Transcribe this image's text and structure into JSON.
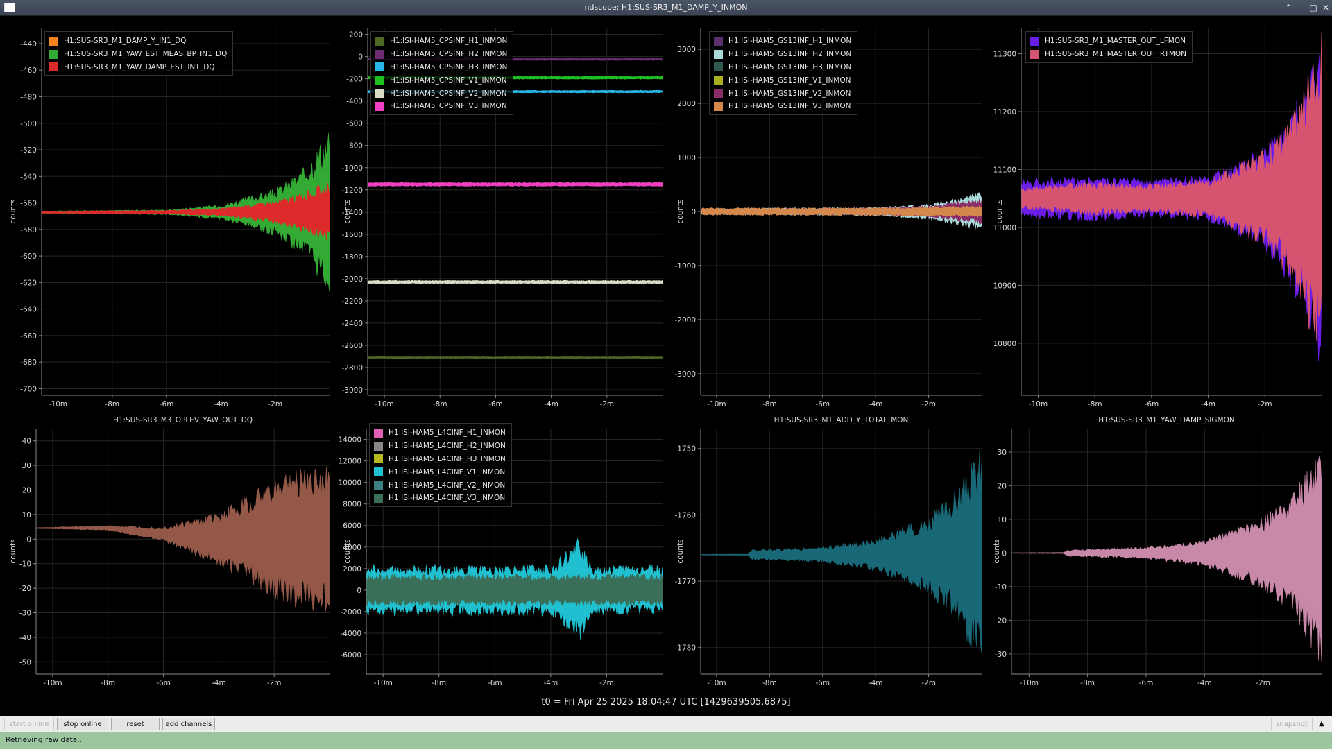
{
  "window": {
    "title": "ndscope: H1:SUS-SR3_M1_DAMP_Y_INMON"
  },
  "x_axis": {
    "ticks": [
      "-10m",
      "-8m",
      "-6m",
      "-4m",
      "-2m"
    ],
    "values": [
      -10,
      -8,
      -6,
      -4,
      -2
    ],
    "xlim": [
      -10.6,
      0
    ]
  },
  "plots": [
    {
      "title": "",
      "ylabel": "counts",
      "ylim": [
        -705,
        -428
      ],
      "yticks": [
        -440,
        -460,
        -480,
        -500,
        -520,
        -540,
        -560,
        -580,
        -600,
        -620,
        -640,
        -660,
        -680,
        -700
      ],
      "legend": [
        {
          "name": "H1:SUS-SR3_M1_DAMP_Y_IN1_DQ",
          "color": "#f58220"
        },
        {
          "name": "H1:SUS-SR3_M1_YAW_EST_MEAS_BP_IN1_DQ",
          "color": "#33aa33"
        },
        {
          "name": "H1:SUS-SR3_M1_YAW_DAMP_EST_IN1_DQ",
          "color": "#dd2a2a"
        }
      ]
    },
    {
      "title": "",
      "ylabel": "counts",
      "ylim": [
        -3050,
        260
      ],
      "yticks": [
        200,
        0,
        -200,
        -400,
        -600,
        -800,
        -1000,
        -1200,
        -1400,
        -1600,
        -1800,
        -2000,
        -2200,
        -2400,
        -2600,
        -2800,
        -3000
      ],
      "legend": [
        {
          "name": "H1:ISI-HAM5_CPSINF_H1_INMON",
          "color": "#4e6a22"
        },
        {
          "name": "H1:ISI-HAM5_CPSINF_H2_INMON",
          "color": "#6b2c72"
        },
        {
          "name": "H1:ISI-HAM5_CPSINF_H3_INMON",
          "color": "#29b6e6"
        },
        {
          "name": "H1:ISI-HAM5_CPSINF_V1_INMON",
          "color": "#20c020"
        },
        {
          "name": "H1:ISI-HAM5_CPSINF_V2_INMON",
          "color": "#d8ddc8"
        },
        {
          "name": "H1:ISI-HAM5_CPSINF_V3_INMON",
          "color": "#ee40c0"
        }
      ]
    },
    {
      "title": "",
      "ylabel": "counts",
      "ylim": [
        -3400,
        3400
      ],
      "yticks": [
        3000,
        2000,
        1000,
        0,
        -1000,
        -2000,
        -3000
      ],
      "legend": [
        {
          "name": "H1:ISI-HAM5_GS13INF_H1_INMON",
          "color": "#5a2f6e"
        },
        {
          "name": "H1:ISI-HAM5_GS13INF_H2_INMON",
          "color": "#a8d8d8"
        },
        {
          "name": "H1:ISI-HAM5_GS13INF_H3_INMON",
          "color": "#2e5a50"
        },
        {
          "name": "H1:ISI-HAM5_GS13INF_V1_INMON",
          "color": "#a8b020"
        },
        {
          "name": "H1:ISI-HAM5_GS13INF_V2_INMON",
          "color": "#8a2e6a"
        },
        {
          "name": "H1:ISI-HAM5_GS13INF_V3_INMON",
          "color": "#d4884c"
        }
      ]
    },
    {
      "title": "",
      "ylabel": "counts",
      "ylim": [
        10710,
        11345
      ],
      "yticks": [
        11300,
        11200,
        11100,
        11000,
        10900,
        10800
      ],
      "legend": [
        {
          "name": "H1:SUS-SR3_M1_MASTER_OUT_LFMON",
          "color": "#6a1ee8"
        },
        {
          "name": "H1:SUS-SR3_M1_MASTER_OUT_RTMON",
          "color": "#d65470"
        }
      ]
    },
    {
      "title": "H1:SUS-SR3_M3_OPLEV_YAW_OUT_DQ",
      "ylabel": "counts",
      "ylim": [
        -55,
        45
      ],
      "yticks": [
        40,
        30,
        20,
        10,
        0,
        -10,
        -20,
        -30,
        -40,
        -50
      ],
      "legend": []
    },
    {
      "title": "",
      "ylabel": "counts",
      "ylim": [
        -7800,
        15000
      ],
      "yticks": [
        14000,
        12000,
        10000,
        8000,
        6000,
        4000,
        2000,
        0,
        -2000,
        -4000,
        -6000
      ],
      "legend": [
        {
          "name": "H1:ISI-HAM5_L4CINF_H1_INMON",
          "color": "#e060b8"
        },
        {
          "name": "H1:ISI-HAM5_L4CINF_H2_INMON",
          "color": "#888888"
        },
        {
          "name": "H1:ISI-HAM5_L4CINF_H3_INMON",
          "color": "#b8b820"
        },
        {
          "name": "H1:ISI-HAM5_L4CINF_V1_INMON",
          "color": "#20c0d0"
        },
        {
          "name": "H1:ISI-HAM5_L4CINF_V2_INMON",
          "color": "#3a8080"
        },
        {
          "name": "H1:ISI-HAM5_L4CINF_V3_INMON",
          "color": "#3a6e58"
        }
      ]
    },
    {
      "title": "H1:SUS-SR3_M1_ADD_Y_TOTAL_MON",
      "ylabel": "counts",
      "ylim": [
        -1784,
        -1747
      ],
      "yticks": [
        -1750,
        -1760,
        -1770,
        -1780
      ],
      "legend": []
    },
    {
      "title": "H1:SUS-SR3_M1_YAW_DAMP_SIGMON",
      "ylabel": "counts",
      "ylim": [
        -36,
        37
      ],
      "yticks": [
        30,
        20,
        10,
        0,
        -10,
        -20,
        -30
      ],
      "legend": []
    }
  ],
  "chart_data": [
    {
      "type": "area",
      "ylabel": "counts",
      "series": [
        {
          "name": "H1:SUS-SR3_M1_YAW_EST_MEAS_BP_IN1_DQ",
          "color": "#33aa33",
          "x": [
            -10.6,
            -6,
            -4,
            -2,
            -1,
            0
          ],
          "center": [
            -567,
            -567,
            -567,
            -567,
            -567,
            -567
          ],
          "amp": [
            1,
            2,
            6,
            18,
            33,
            65
          ]
        },
        {
          "name": "H1:SUS-SR3_M1_YAW_DAMP_EST_IN1_DQ",
          "color": "#dd2a2a",
          "x": [
            -10.6,
            -6,
            -4,
            -2,
            -1,
            0
          ],
          "center": [
            -567,
            -567,
            -567,
            -567,
            -567,
            -567
          ],
          "amp": [
            1,
            1.5,
            3,
            9,
            15,
            24
          ]
        }
      ]
    },
    {
      "type": "area",
      "ylabel": "counts",
      "series": [
        {
          "name": "H1:ISI-HAM5_CPSINF_H2_INMON",
          "color": "#6b2c72",
          "x": [
            -10.6,
            0
          ],
          "center": [
            -25,
            -25
          ],
          "amp": [
            10,
            10
          ]
        },
        {
          "name": "H1:ISI-HAM5_CPSINF_V1_INMON",
          "color": "#20c020",
          "x": [
            -10.6,
            0
          ],
          "center": [
            -190,
            -190
          ],
          "amp": [
            14,
            14
          ]
        },
        {
          "name": "H1:ISI-HAM5_CPSINF_H3_INMON",
          "color": "#29b6e6",
          "x": [
            -10.6,
            0
          ],
          "center": [
            -315,
            -315
          ],
          "amp": [
            12,
            12
          ]
        },
        {
          "name": "H1:ISI-HAM5_CPSINF_V3_INMON",
          "color": "#ee40c0",
          "x": [
            -10.6,
            0
          ],
          "center": [
            -1150,
            -1150
          ],
          "amp": [
            18,
            18
          ]
        },
        {
          "name": "H1:ISI-HAM5_CPSINF_V2_INMON",
          "color": "#d8ddc8",
          "x": [
            -10.6,
            0
          ],
          "center": [
            -2030,
            -2030
          ],
          "amp": [
            16,
            16
          ]
        },
        {
          "name": "H1:ISI-HAM5_CPSINF_H1_INMON",
          "color": "#4e6a22",
          "x": [
            -10.6,
            0
          ],
          "center": [
            -2710,
            -2710
          ],
          "amp": [
            8,
            8
          ]
        }
      ]
    },
    {
      "type": "area",
      "ylabel": "counts",
      "series": [
        {
          "name": "H1:ISI-HAM5_GS13INF_H2_INMON",
          "color": "#a8d8d8",
          "x": [
            -10.6,
            -4,
            -2,
            -1,
            0
          ],
          "center": [
            0,
            0,
            0,
            0,
            0
          ],
          "amp": [
            60,
            80,
            150,
            250,
            380
          ]
        },
        {
          "name": "H1:ISI-HAM5_GS13INF_V2_INMON",
          "color": "#8a2e6a",
          "x": [
            -10.6,
            -4,
            -2,
            -1,
            0
          ],
          "center": [
            0,
            0,
            0,
            0,
            0
          ],
          "amp": [
            50,
            70,
            110,
            180,
            250
          ]
        },
        {
          "name": "H1:ISI-HAM5_GS13INF_V3_INMON",
          "color": "#d4884c",
          "x": [
            -10.6,
            -4,
            -2,
            -1,
            0
          ],
          "center": [
            0,
            0,
            0,
            0,
            0
          ],
          "amp": [
            70,
            80,
            90,
            100,
            110
          ]
        }
      ]
    },
    {
      "type": "area",
      "ylabel": "counts",
      "series": [
        {
          "name": "H1:SUS-SR3_M1_MASTER_OUT_LFMON",
          "color": "#6a1ee8",
          "x": [
            -10.6,
            -8,
            -6,
            -4,
            -2,
            -1,
            0
          ],
          "center": [
            11050,
            11050,
            11050,
            11050,
            11050,
            11050,
            11050
          ],
          "amp": [
            35,
            40,
            35,
            40,
            90,
            160,
            300
          ]
        },
        {
          "name": "H1:SUS-SR3_M1_MASTER_OUT_RTMON",
          "color": "#d65470",
          "x": [
            -10.6,
            -8,
            -6,
            -4,
            -2,
            -1,
            0
          ],
          "center": [
            11050,
            11050,
            11050,
            11050,
            11050,
            11050,
            11050
          ],
          "amp": [
            20,
            30,
            25,
            35,
            85,
            150,
            290
          ]
        }
      ]
    },
    {
      "type": "area",
      "title": "H1:SUS-SR3_M3_OPLEV_YAW_OUT_DQ",
      "ylabel": "counts",
      "series": [
        {
          "color": "#945848",
          "x": [
            -10.6,
            -8,
            -6,
            -4,
            -2,
            -1,
            0
          ],
          "center": [
            4.5,
            4.5,
            2,
            0,
            0,
            0,
            0
          ],
          "amp": [
            0.2,
            1,
            3,
            11,
            25,
            30,
            30
          ]
        }
      ]
    },
    {
      "type": "area",
      "ylabel": "counts",
      "series": [
        {
          "name": "H1:ISI-HAM5_L4CINF_V1_INMON",
          "color": "#20c0d0",
          "x": [
            -10.6,
            -4,
            -3.1,
            -3,
            -2.5,
            0
          ],
          "center": [
            0,
            0,
            0,
            0,
            0,
            0
          ],
          "amp": [
            2400,
            2400,
            4500,
            5200,
            2400,
            2400
          ]
        },
        {
          "name": "H1:ISI-HAM5_L4CINF_V3_INMON",
          "color": "#3a6e58",
          "x": [
            -10.6,
            0
          ],
          "center": [
            0,
            0
          ],
          "amp": [
            1500,
            1500
          ]
        }
      ]
    },
    {
      "type": "area",
      "title": "H1:SUS-SR3_M1_ADD_Y_TOTAL_MON",
      "ylabel": "counts",
      "series": [
        {
          "color": "#186878",
          "x": [
            -10.6,
            -8.8,
            -8.7,
            -6,
            -4,
            -2,
            -1,
            0
          ],
          "center": [
            -1766,
            -1766,
            -1766,
            -1766,
            -1766,
            -1766,
            -1766,
            -1766
          ],
          "amp": [
            0.05,
            0.1,
            0.8,
            1.2,
            2.5,
            6,
            10,
            17
          ]
        }
      ]
    },
    {
      "type": "area",
      "title": "H1:SUS-SR3_M1_YAW_DAMP_SIGMON",
      "ylabel": "counts",
      "series": [
        {
          "color": "#c888a8",
          "x": [
            -10.6,
            -8.8,
            -8.7,
            -6,
            -4,
            -2,
            -1,
            0
          ],
          "center": [
            0,
            0,
            0,
            0,
            0,
            0,
            0,
            0
          ],
          "amp": [
            0.1,
            0.2,
            1,
            1.8,
            4,
            11,
            18,
            34
          ]
        }
      ]
    }
  ],
  "t0_label": "t0 = Fri Apr 25 2025 18:04:47 UTC [1429639505.6875]",
  "toolbar": {
    "start_label": "start online",
    "stop_label": "stop online",
    "reset_label": "reset",
    "add_label": "add channels",
    "right_label": "snapshot"
  },
  "status": "Retrieving raw data..."
}
